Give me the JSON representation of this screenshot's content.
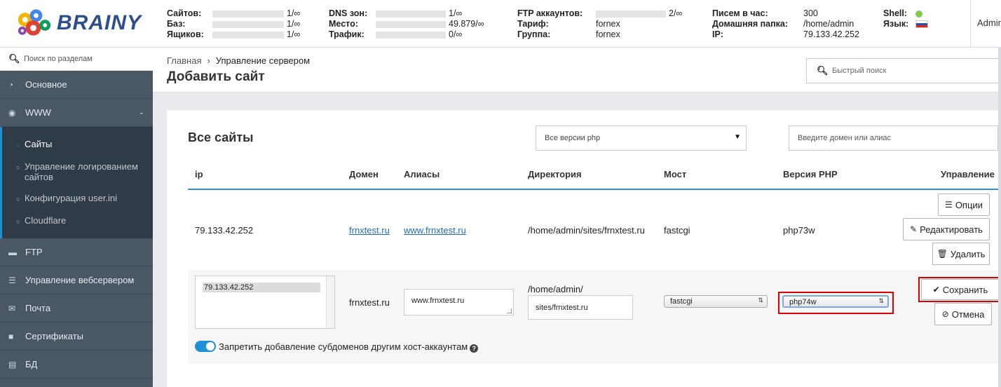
{
  "logo": {
    "text": "BRAINY"
  },
  "header": {
    "col1": [
      {
        "label": "Сайтов:",
        "value": "1/∞"
      },
      {
        "label": "Баз:",
        "value": "1/∞"
      },
      {
        "label": "Ящиков:",
        "value": "1/∞"
      }
    ],
    "col2": [
      {
        "label": "DNS зон:",
        "value": "1/∞"
      },
      {
        "label": "Место:",
        "value": "49.879/∞"
      },
      {
        "label": "Трафик:",
        "value": "0/∞"
      }
    ],
    "col3": [
      {
        "label": "FTP аккаунтов:",
        "value": "2/∞"
      },
      {
        "label": "Тариф:",
        "value": "fornex"
      },
      {
        "label": "Группа:",
        "value": "fornex"
      }
    ],
    "col4": [
      {
        "label": "Писем в час:",
        "value": "300"
      },
      {
        "label": "Домашняя папка:",
        "value": "/home/admin"
      },
      {
        "label": "IP:",
        "value": "79.133.42.252"
      }
    ],
    "col5": [
      {
        "label": "Shell:"
      },
      {
        "label": "Язык:"
      }
    ],
    "user": "Admin"
  },
  "sidebar": {
    "search_placeholder": "Поиск по разделам",
    "items_top": [
      {
        "label": "Основное",
        "icon": "dashboard-icon"
      },
      {
        "label": "WWW",
        "icon": "globe-icon"
      }
    ],
    "submenu": [
      {
        "label": "Сайты"
      },
      {
        "label": "Управление логированием сайтов"
      },
      {
        "label": "Конфигурация user.ini"
      },
      {
        "label": "Cloudflare"
      }
    ],
    "items_bottom": [
      {
        "label": "FTP",
        "icon": "folder-icon"
      },
      {
        "label": "Управление вебсервером",
        "icon": "server-icon"
      },
      {
        "label": "Почта",
        "icon": "envelope-icon"
      },
      {
        "label": "Сертификаты",
        "icon": "lock-icon"
      },
      {
        "label": "БД",
        "icon": "database-icon"
      }
    ]
  },
  "page": {
    "breadcrumb_home": "Главная",
    "breadcrumb_current": "Управление сервером",
    "title": "Добавить сайт",
    "quick_search_placeholder": "Быстрый поиск"
  },
  "card": {
    "title": "Все сайты",
    "php_filter": "Все версии php",
    "domain_filter_placeholder": "Введите домен или алиас",
    "columns": [
      "ip",
      "Домен",
      "Алиасы",
      "Директория",
      "Мост",
      "Версия PHP",
      "Управление"
    ],
    "row1": {
      "ip": "79.133.42.252",
      "domain": "frnxtest.ru",
      "alias": "www.frnxtest.ru",
      "dir": "/home/admin/sites/frnxtest.ru",
      "bridge": "fastcgi",
      "php": "php73w",
      "btn_options": "Опции",
      "btn_edit": "Редактировать",
      "btn_delete": "Удалить"
    },
    "row2": {
      "ip_option": "79.133.42.252",
      "domain": "frnxtest.ru",
      "alias_value": "www.frnxtest.ru",
      "dir_prefix": "/home/admin/",
      "dir_value": "sites/frnxtest.ru",
      "bridge_value": "fastcgi",
      "php_value": "php74w",
      "btn_save": "Сохранить",
      "btn_cancel": "Отмена",
      "toggle_label": "Запретить добавление субдоменов другим хост-аккаунтам"
    }
  },
  "colors": {
    "accent": "#1e90d6",
    "highlight": "#e00000",
    "sidebar": "#4a5866"
  }
}
